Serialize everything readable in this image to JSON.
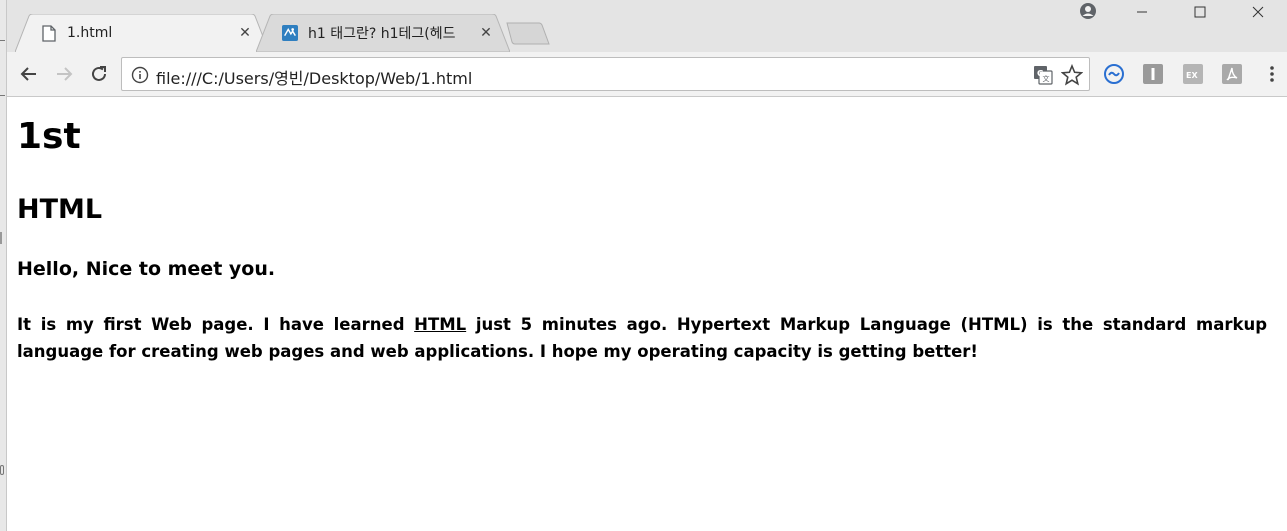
{
  "browser": {
    "tabs": [
      {
        "title": "1.html",
        "favicon": "file-icon",
        "active": true
      },
      {
        "title": "h1 태그란? h1테그(헤드",
        "favicon": "site-icon",
        "active": false
      }
    ],
    "address": "file:///C:/Users/영빈/Desktop/Web/1.html",
    "tab_close_glyph": "✕"
  },
  "page": {
    "h1": "1st",
    "h2": "HTML",
    "h3": "Hello, Nice to meet you.",
    "paragraph": {
      "before": "It is my first Web page. I have learned ",
      "link": "HTML",
      "after": " just 5 minutes ago. Hypertext Markup Language (HTML) is the standard markup language for creating web pages and web applications. I hope my operating capacity is getting better!"
    }
  },
  "extensions": [
    "sync-icon",
    "i-extension-icon",
    "ex-extension-icon",
    "pdf-extension-icon"
  ]
}
